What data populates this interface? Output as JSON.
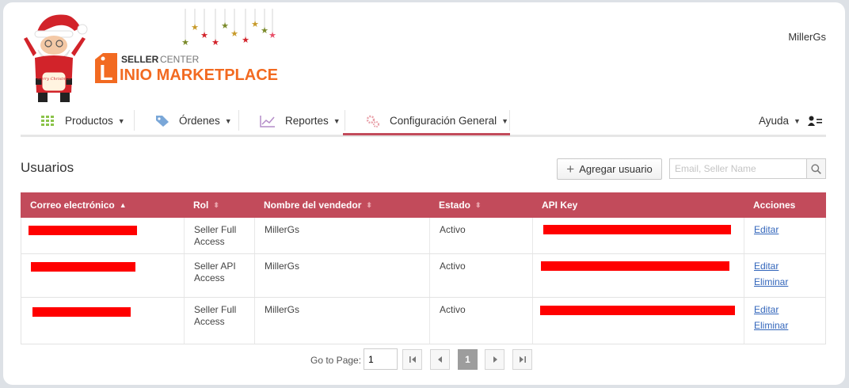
{
  "header": {
    "user_name": "MillerGs",
    "brand_line1_a": "SELLER",
    "brand_line1_b": "CENTER",
    "brand_line2": "INIO MARKETPLACE",
    "brand_letter": "L",
    "santa_sign": "Merry Christmas"
  },
  "nav": {
    "items": [
      {
        "label": "Productos",
        "icon": "grid-icon"
      },
      {
        "label": "Órdenes",
        "icon": "tag-icon"
      },
      {
        "label": "Reportes",
        "icon": "chart-line-icon"
      },
      {
        "label": "Configuración General",
        "icon": "gears-icon"
      }
    ],
    "help_label": "Ayuda",
    "active_index": 3,
    "accent_color": "#c24b5b"
  },
  "page": {
    "title": "Usuarios",
    "add_button": "Agregar usuario",
    "search_placeholder": "Email, Seller Name"
  },
  "table": {
    "columns": [
      "Correo electrónico",
      "Rol",
      "Nombre del vendedor",
      "Estado",
      "API Key",
      "Acciones"
    ],
    "rows": [
      {
        "email": "",
        "role": "Seller Full Access",
        "seller": "MillerGs",
        "status": "Activo",
        "api_key": "",
        "actions": [
          "Editar"
        ]
      },
      {
        "email": "",
        "role": "Seller API Access",
        "seller": "MillerGs",
        "status": "Activo",
        "api_key": "",
        "actions": [
          "Editar",
          "Eliminar"
        ]
      },
      {
        "email": "",
        "role": "Seller Full Access",
        "seller": "MillerGs",
        "status": "Activo",
        "api_key": "",
        "actions": [
          "Editar",
          "Eliminar"
        ]
      }
    ]
  },
  "pagination": {
    "label": "Go to Page:",
    "input_value": "1",
    "current_page": "1"
  }
}
